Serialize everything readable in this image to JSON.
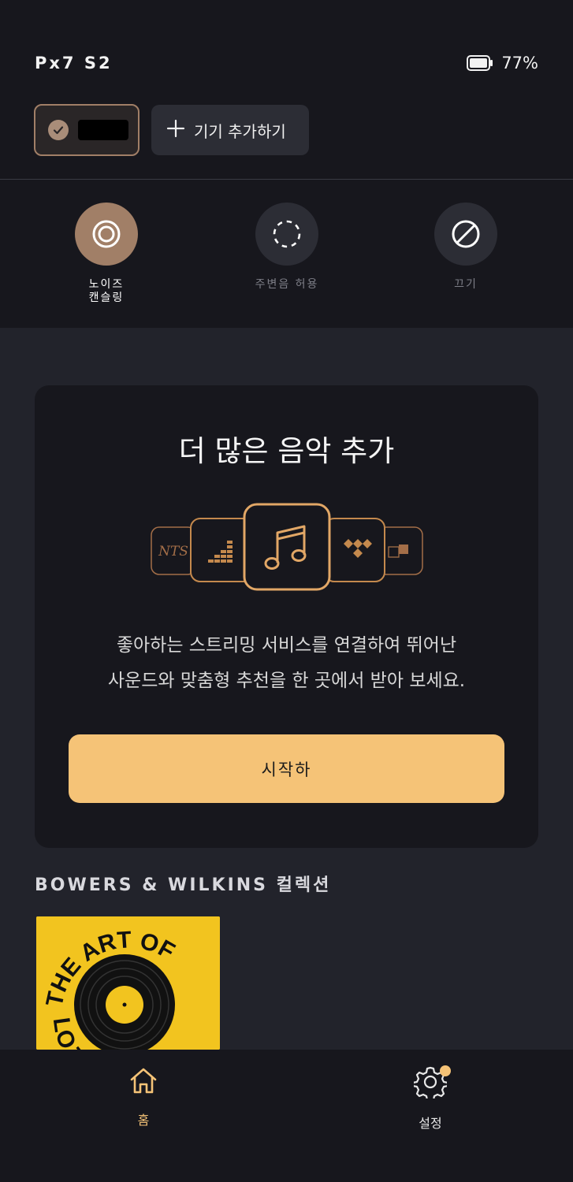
{
  "header": {
    "device_name": "Px7 S2",
    "battery_percent_label": "77%",
    "battery_level": 0.77
  },
  "devices": {
    "add_device_label": "기기 추가하기"
  },
  "anc_modes": [
    {
      "label": "노이즈\n캔슬링",
      "icon": "anc-active-icon",
      "active": true
    },
    {
      "label": "주변음 허용",
      "icon": "transparency-icon",
      "active": false
    },
    {
      "label": "끄기",
      "icon": "off-icon",
      "active": false
    }
  ],
  "promo_card": {
    "title": "더 많은 음악 추가",
    "description_line1": "좋아하는 스트리밍 서비스를 연결하여 뛰어난",
    "description_line2": "사운드와 맞춤형 추천을 한 곳에서 받아 보세요.",
    "cta_label": "시작하",
    "service_logos": [
      "NTS",
      "deezer-icon",
      "music-note-icon",
      "tidal-icon",
      "tunein-icon"
    ],
    "nts_text": "NTS"
  },
  "collection": {
    "title": "BOWERS & WILKINS 컬렉션",
    "album_text_top": "THE ART OF",
    "album_text_bottom": "LO TY"
  },
  "bottom_nav": [
    {
      "label": "홈",
      "icon": "home-icon",
      "active": true
    },
    {
      "label": "설정",
      "icon": "gear-icon",
      "active": false,
      "badge": true
    }
  ],
  "colors": {
    "accent": "#f5c377",
    "bronze": "#a17f67",
    "panel": "#17171d",
    "background": "#22232b"
  }
}
